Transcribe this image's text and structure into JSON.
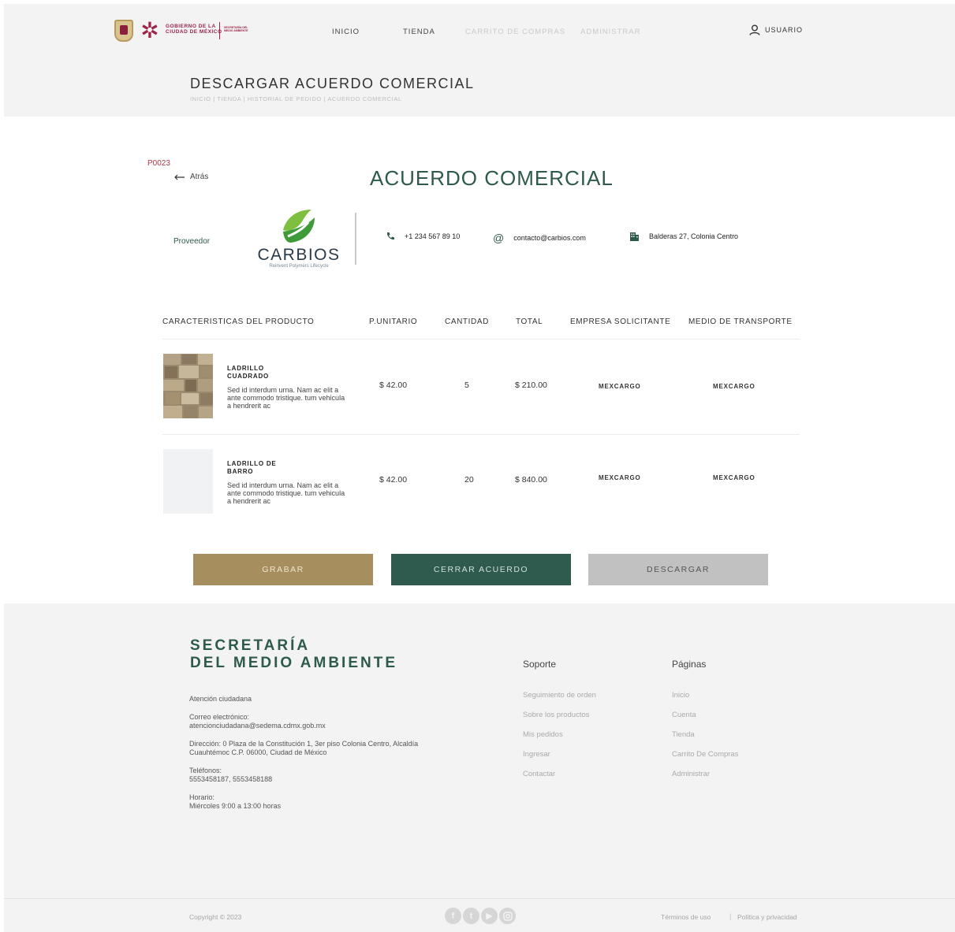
{
  "header": {
    "logo_line1": "GOBIERNO DE LA",
    "logo_line2": "CIUDAD DE MÉXICO",
    "logo_secretaria": "SECRETARÍA DEL MEDIO AMBIENTE",
    "nav": [
      "INICIO",
      "TIENDA",
      "CARRITO DE COMPRAS",
      "ADMINISTRAR"
    ],
    "user_label": "USUARIO"
  },
  "page": {
    "title": "DESCARGAR ACUERDO COMERCIAL",
    "breadcrumb": "INICIO | TIENDA | HISTORIAL DE PEDIDO | ACUERDO COMERCIAL"
  },
  "agreement": {
    "order_code": "P0023",
    "back_label": "Atrás",
    "title": "ACUERDO COMERCIAL",
    "provider_label": "Proveedor",
    "provider": {
      "name": "CARBIOS",
      "tagline": "Reinvent Polymers Lifecycle",
      "phone": "+1 234 567 89 10",
      "email": "contacto@carbios.com",
      "address": "Balderas 27, Colonia Centro"
    }
  },
  "table": {
    "headers": [
      "CARACTERISTICAS DEL PRODUCTO",
      "P.UNITARIO",
      "CANTIDAD",
      "TOTAL",
      "EMPRESA SOLICITANTE",
      "MEDIO DE TRANSPORTE"
    ],
    "rows": [
      {
        "name": "LADRILLO CUADRADO",
        "description": "Sed id interdum urna. Nam ac elit a ante commodo tristique. tum vehicula a hendrerit ac",
        "unit_price": "$ 42.00",
        "quantity": "5",
        "total": "$ 210.00",
        "company": "MEXCARGO",
        "transport": "MEXCARGO"
      },
      {
        "name": "LADRILLO DE BARRO",
        "description": "Sed id interdum urna. Nam ac elit a ante commodo tristique. tum vehicula a hendrerit ac",
        "unit_price": "$ 42.00",
        "quantity": "20",
        "total": "$ 840.00",
        "company": "MEXCARGO",
        "transport": "MEXCARGO"
      }
    ]
  },
  "actions": {
    "save": "GRABAR",
    "close": "CERRAR ACUERDO",
    "download": "DESCARGAR"
  },
  "footer": {
    "brand_line1": "SECRETARÍA",
    "brand_line2": "DEL MEDIO AMBIENTE",
    "attention": "Atención ciudadana",
    "email_label": "Correo electrónico:",
    "email": "atencionciudadana@sedema.cdmx.gob.mx",
    "address": "Dirección: 0 Plaza de la Constitución 1, 3er piso Colonia Centro, Alcaldía Cuauhtémoc C.P. 06000, Ciudad de México",
    "phones_label": "Teléfonos:",
    "phones": "5553458187, 5553458188",
    "schedule_label": "Horario:",
    "schedule": "Miércoles 9:00 a 13:00 horas",
    "support_title": "Soporte",
    "support_links": [
      "Seguimiento de orden",
      "Sobre los productos",
      "Mis pedidos",
      "Ingresar",
      "Contactar"
    ],
    "pages_title": "Páginas",
    "pages_links": [
      "Inicio",
      "Cuenta",
      "Tienda",
      "Carrito De Compras",
      "Administrar"
    ],
    "copyright": "Copyright © 2023",
    "terms": "Términos de uso",
    "privacy": "Política y privacidad",
    "separator": "|",
    "social_icons": [
      "facebook-icon",
      "twitter-icon",
      "youtube-icon",
      "instagram-icon"
    ]
  },
  "colors": {
    "brand_green": "#2e5a4d",
    "gold": "#a78e5e",
    "gray_button": "#c1c1c1",
    "gov_maroon": "#9d2348",
    "order_red": "#b23a48"
  }
}
